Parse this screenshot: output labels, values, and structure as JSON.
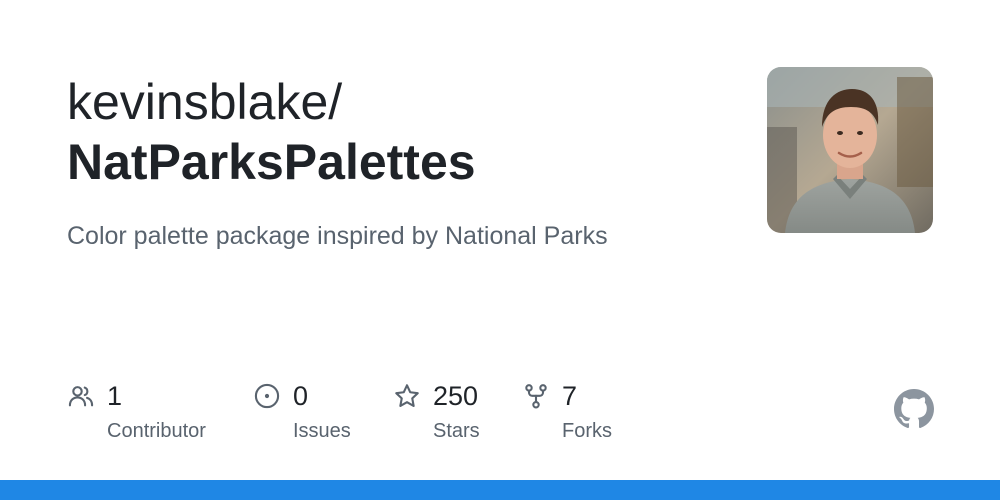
{
  "repo": {
    "owner": "kevinsblake/",
    "name": "NatParksPalettes",
    "description": "Color palette package inspired by National Parks"
  },
  "stats": {
    "contributors": {
      "count": "1",
      "label": "Contributor",
      "icon": "people-icon"
    },
    "issues": {
      "count": "0",
      "label": "Issues",
      "icon": "issue-circle-icon"
    },
    "stars": {
      "count": "250",
      "label": "Stars",
      "icon": "star-icon"
    },
    "forks": {
      "count": "7",
      "label": "Forks",
      "icon": "fork-icon"
    }
  },
  "colors": {
    "text_primary": "#1f2328",
    "text_muted": "#59636e",
    "bottom_bar": "#1f87e5",
    "logo": "#8c959f"
  }
}
